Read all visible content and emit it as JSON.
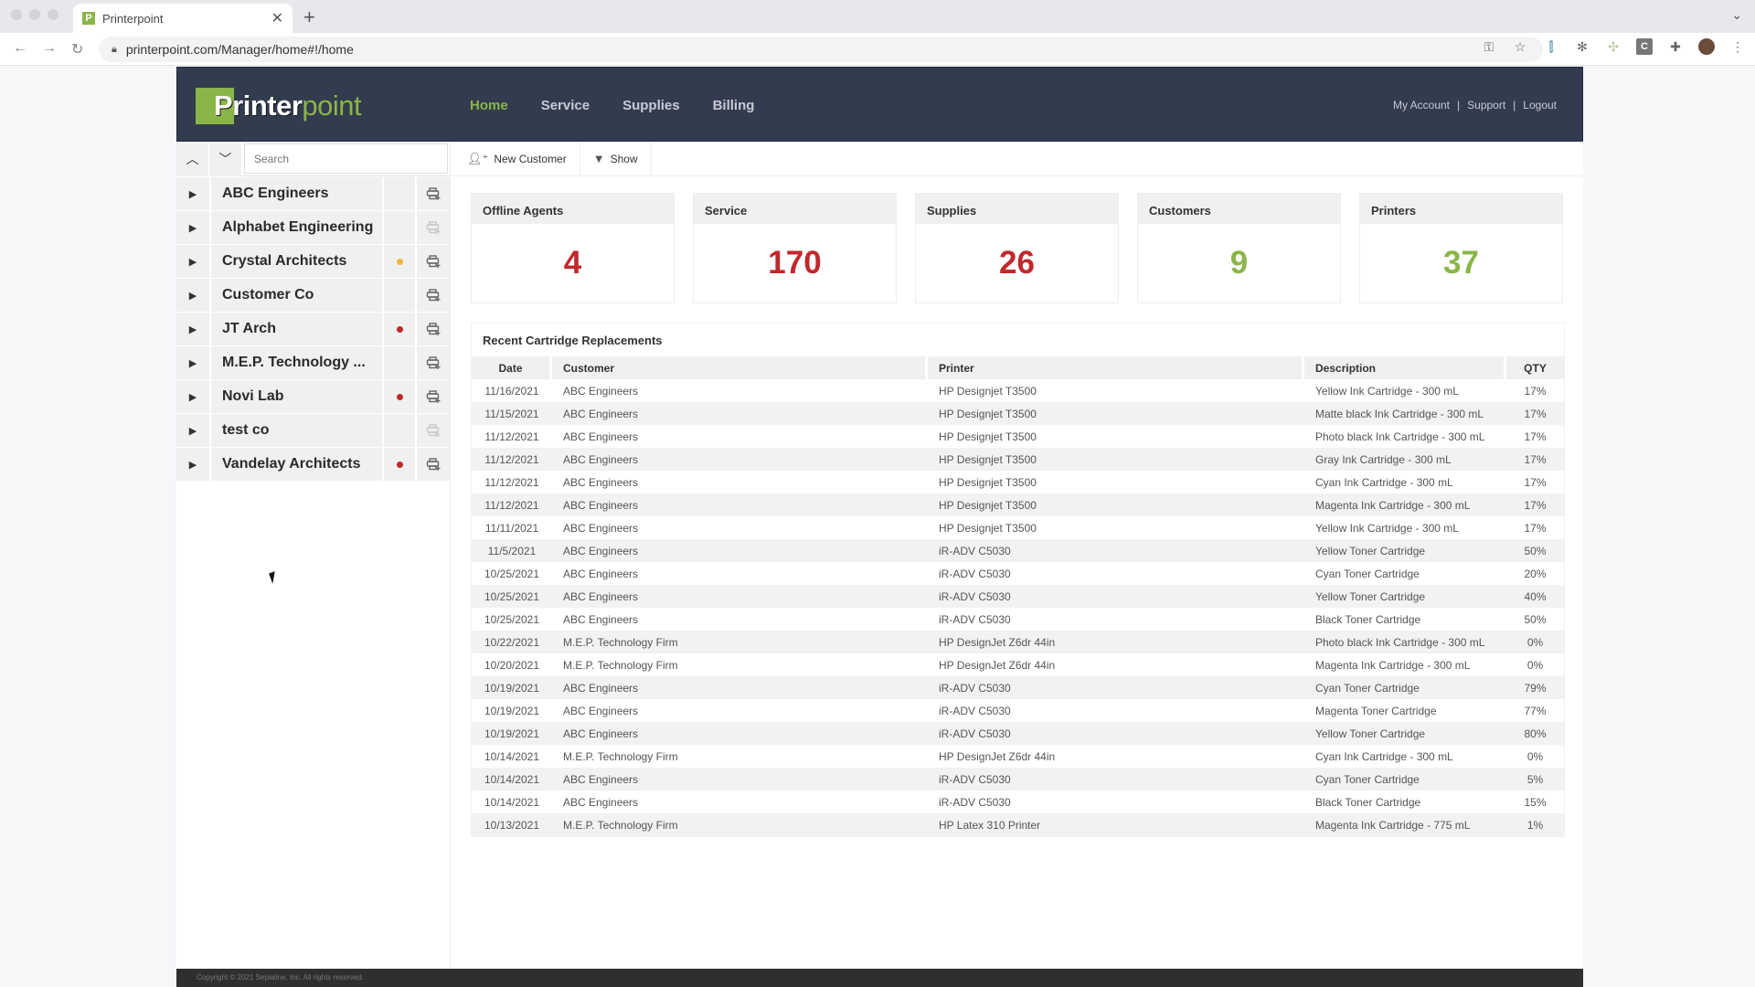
{
  "browser": {
    "tab_title": "Printerpoint",
    "favicon_letter": "P",
    "url": "printerpoint.com/Manager/home#!/home",
    "close_glyph": "✕",
    "newtab_glyph": "+"
  },
  "header": {
    "logo_part1": "Printer",
    "logo_part2": "point",
    "nav": [
      {
        "label": "Home",
        "active": true
      },
      {
        "label": "Service",
        "active": false
      },
      {
        "label": "Supplies",
        "active": false
      },
      {
        "label": "Billing",
        "active": false
      }
    ],
    "user_links": [
      "My Account",
      "Support",
      "Logout"
    ]
  },
  "sidebar": {
    "search_placeholder": "Search",
    "customers": [
      {
        "name": "ABC Engineers",
        "status": null,
        "add_enabled": true
      },
      {
        "name": "Alphabet Engineering",
        "status": null,
        "add_enabled": false
      },
      {
        "name": "Crystal Architects",
        "status": "warning",
        "add_enabled": true
      },
      {
        "name": "Customer Co",
        "status": null,
        "add_enabled": true
      },
      {
        "name": "JT Arch",
        "status": "error",
        "add_enabled": true
      },
      {
        "name": "M.E.P. Technology ...",
        "status": null,
        "add_enabled": true
      },
      {
        "name": "Novi Lab",
        "status": "error",
        "add_enabled": true
      },
      {
        "name": "test co",
        "status": null,
        "add_enabled": false
      },
      {
        "name": "Vandelay Architects",
        "status": "error",
        "add_enabled": true
      }
    ]
  },
  "toolbar": {
    "new_customer_label": "New Customer",
    "show_label": "Show"
  },
  "cards": [
    {
      "title": "Offline Agents",
      "value": "4",
      "color": "#c0282d"
    },
    {
      "title": "Service",
      "value": "170",
      "color": "#c0282d"
    },
    {
      "title": "Supplies",
      "value": "26",
      "color": "#c0282d"
    },
    {
      "title": "Customers",
      "value": "9",
      "color": "#8ab548"
    },
    {
      "title": "Printers",
      "value": "37",
      "color": "#8ab548"
    }
  ],
  "recent": {
    "title": "Recent Cartridge Replacements",
    "columns": [
      "Date",
      "Customer",
      "Printer",
      "Description",
      "QTY"
    ],
    "rows": [
      [
        "11/16/2021",
        "ABC Engineers",
        "HP Designjet T3500",
        "Yellow Ink Cartridge - 300 mL",
        "17%"
      ],
      [
        "11/15/2021",
        "ABC Engineers",
        "HP Designjet T3500",
        "Matte black Ink Cartridge - 300 mL",
        "17%"
      ],
      [
        "11/12/2021",
        "ABC Engineers",
        "HP Designjet T3500",
        "Photo black Ink Cartridge - 300 mL",
        "17%"
      ],
      [
        "11/12/2021",
        "ABC Engineers",
        "HP Designjet T3500",
        "Gray Ink Cartridge - 300 mL",
        "17%"
      ],
      [
        "11/12/2021",
        "ABC Engineers",
        "HP Designjet T3500",
        "Cyan Ink Cartridge - 300 mL",
        "17%"
      ],
      [
        "11/12/2021",
        "ABC Engineers",
        "HP Designjet T3500",
        "Magenta Ink Cartridge - 300 mL",
        "17%"
      ],
      [
        "11/11/2021",
        "ABC Engineers",
        "HP Designjet T3500",
        "Yellow Ink Cartridge - 300 mL",
        "17%"
      ],
      [
        "11/5/2021",
        "ABC Engineers",
        "iR-ADV C5030",
        "Yellow Toner Cartridge",
        "50%"
      ],
      [
        "10/25/2021",
        "ABC Engineers",
        "iR-ADV C5030",
        "Cyan Toner Cartridge",
        "20%"
      ],
      [
        "10/25/2021",
        "ABC Engineers",
        "iR-ADV C5030",
        "Yellow Toner Cartridge",
        "40%"
      ],
      [
        "10/25/2021",
        "ABC Engineers",
        "iR-ADV C5030",
        "Black Toner Cartridge",
        "50%"
      ],
      [
        "10/22/2021",
        "M.E.P. Technology Firm",
        "HP DesignJet Z6dr 44in",
        "Photo black Ink Cartridge - 300 mL",
        "0%"
      ],
      [
        "10/20/2021",
        "M.E.P. Technology Firm",
        "HP DesignJet Z6dr 44in",
        "Magenta Ink Cartridge - 300 mL",
        "0%"
      ],
      [
        "10/19/2021",
        "ABC Engineers",
        "iR-ADV C5030",
        "Cyan Toner Cartridge",
        "79%"
      ],
      [
        "10/19/2021",
        "ABC Engineers",
        "iR-ADV C5030",
        "Magenta Toner Cartridge",
        "77%"
      ],
      [
        "10/19/2021",
        "ABC Engineers",
        "iR-ADV C5030",
        "Yellow Toner Cartridge",
        "80%"
      ],
      [
        "10/14/2021",
        "M.E.P. Technology Firm",
        "HP DesignJet Z6dr 44in",
        "Cyan Ink Cartridge - 300 mL",
        "0%"
      ],
      [
        "10/14/2021",
        "ABC Engineers",
        "iR-ADV C5030",
        "Cyan Toner Cartridge",
        "5%"
      ],
      [
        "10/14/2021",
        "ABC Engineers",
        "iR-ADV C5030",
        "Black Toner Cartridge",
        "15%"
      ],
      [
        "10/13/2021",
        "M.E.P. Technology Firm",
        "HP Latex 310 Printer",
        "Magenta Ink Cartridge - 775 mL",
        "1%"
      ]
    ]
  },
  "footer": {
    "copyright": "Copyright © 2021 Sepialine, Inc. All rights reserved."
  },
  "colors": {
    "brand_green": "#8ab548",
    "header_bg": "#333c4e",
    "alert_red": "#c0282d",
    "warning_yellow": "#f0b43c"
  }
}
